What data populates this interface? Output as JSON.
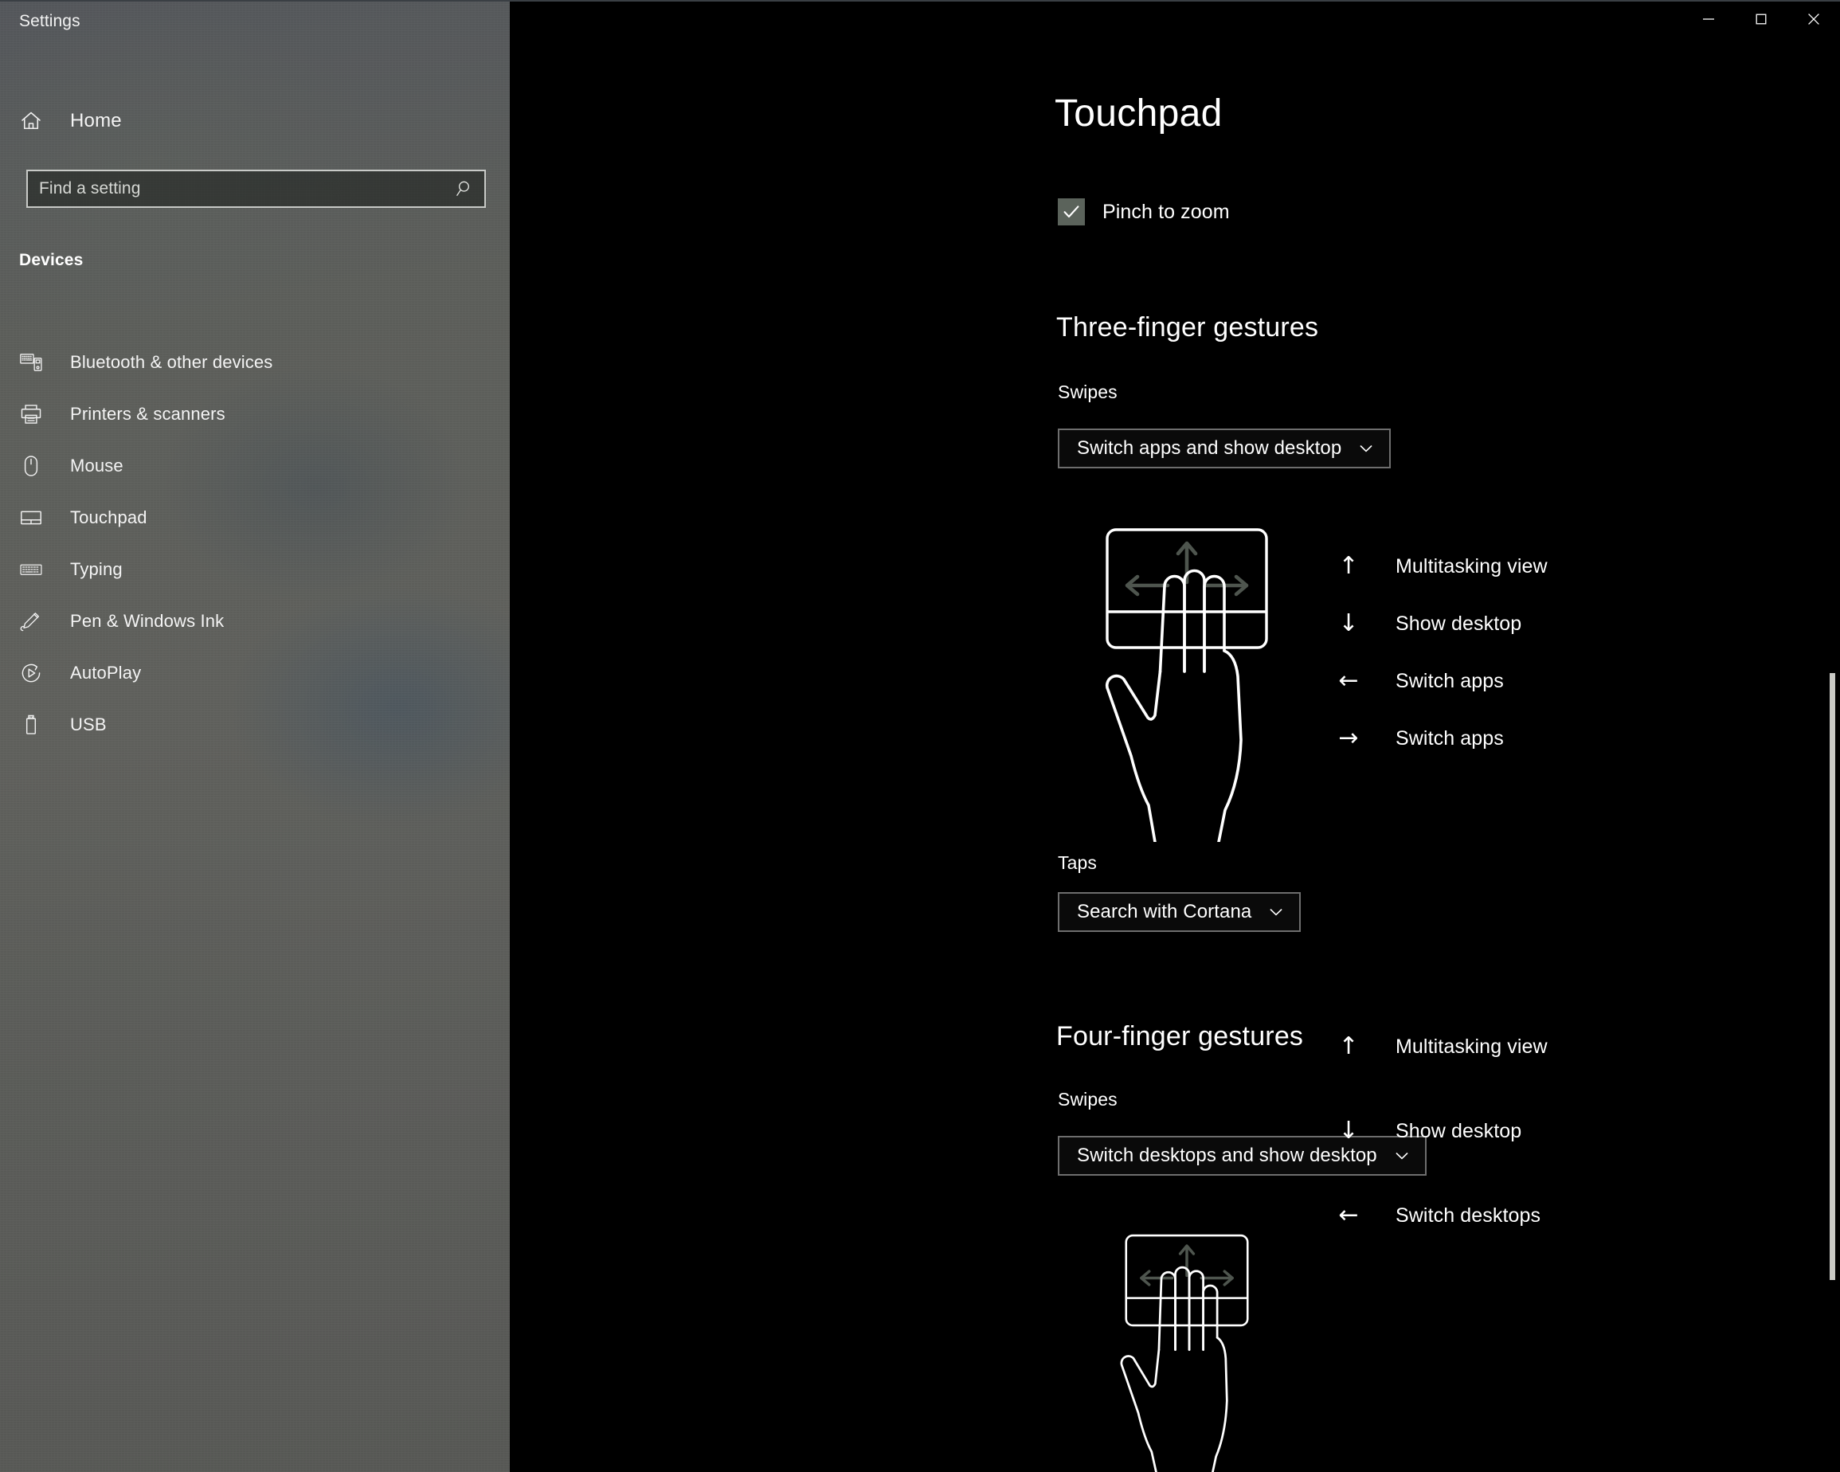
{
  "window": {
    "title": "Settings",
    "controls": [
      {
        "name": "minimize",
        "glyph": "minimize-icon",
        "label": "Minimize"
      },
      {
        "name": "maximize",
        "glyph": "maximize-icon",
        "label": "Maximize"
      },
      {
        "name": "close",
        "glyph": "close-icon",
        "label": "Close"
      }
    ]
  },
  "sidebar": {
    "home_label": "Home",
    "home_icon": "home-icon",
    "search": {
      "placeholder": "Find a setting",
      "value": "",
      "icon": "search-icon"
    },
    "category_header": "Devices",
    "items": [
      {
        "label": "Bluetooth & other devices",
        "icon": "bluetooth-devices-icon",
        "selected": false
      },
      {
        "label": "Printers & scanners",
        "icon": "printer-icon",
        "selected": false
      },
      {
        "label": "Mouse",
        "icon": "mouse-icon",
        "selected": false
      },
      {
        "label": "Touchpad",
        "icon": "touchpad-icon",
        "selected": true
      },
      {
        "label": "Typing",
        "icon": "keyboard-icon",
        "selected": false
      },
      {
        "label": "Pen & Windows Ink",
        "icon": "pen-icon",
        "selected": false
      },
      {
        "label": "AutoPlay",
        "icon": "autoplay-icon",
        "selected": false
      },
      {
        "label": "USB",
        "icon": "usb-icon",
        "selected": false
      }
    ]
  },
  "main": {
    "page_title": "Touchpad",
    "pinch": {
      "label": "Pinch to zoom",
      "checked": true
    },
    "three_finger": {
      "heading": "Three-finger gestures",
      "swipes_label": "Swipes",
      "swipes_value": "Switch apps and show desktop",
      "taps_label": "Taps",
      "taps_value": "Search with Cortana",
      "gestures": [
        {
          "direction": "up",
          "arrow": "↑",
          "label": "Multitasking view"
        },
        {
          "direction": "down",
          "arrow": "↓",
          "label": "Show desktop"
        },
        {
          "direction": "left",
          "arrow": "←",
          "label": "Switch apps"
        },
        {
          "direction": "right",
          "arrow": "→",
          "label": "Switch apps"
        }
      ],
      "illustration": {
        "name": "three-finger-touchpad-illustration",
        "fingers": 3
      }
    },
    "four_finger": {
      "heading": "Four-finger gestures",
      "swipes_label": "Swipes",
      "swipes_value": "Switch desktops and show desktop",
      "gestures": [
        {
          "direction": "up",
          "arrow": "↑",
          "label": "Multitasking view"
        },
        {
          "direction": "down",
          "arrow": "↓",
          "label": "Show desktop"
        },
        {
          "direction": "left",
          "arrow": "←",
          "label": "Switch desktops"
        }
      ],
      "illustration": {
        "name": "four-finger-touchpad-illustration",
        "fingers": 4
      }
    }
  },
  "colors": {
    "page_background": "#000000",
    "sidebar_background": "#5c5d5b",
    "text_primary": "#ffffff",
    "checkbox_fill": "#5b635b",
    "combo_border": "#6e6e6e",
    "scrollbar_thumb": "#c9c9c5",
    "illustration_stroke": "#ffffff",
    "illustration_arrow": "#4e554e"
  }
}
